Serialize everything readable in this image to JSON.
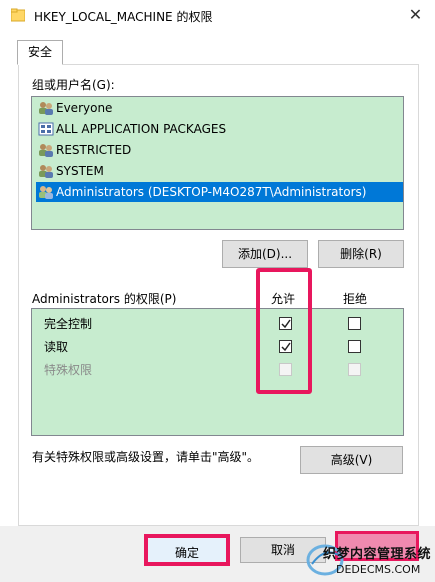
{
  "window": {
    "title": "HKEY_LOCAL_MACHINE 的权限",
    "close_glyph": "✕"
  },
  "tabs": [
    {
      "label": "安全"
    }
  ],
  "users": {
    "label": "组或用户名(G):",
    "items": [
      {
        "name": "Everyone",
        "icon": "user-group-icon"
      },
      {
        "name": "ALL APPLICATION PACKAGES",
        "icon": "app-package-icon"
      },
      {
        "name": "RESTRICTED",
        "icon": "user-group-icon"
      },
      {
        "name": "SYSTEM",
        "icon": "user-group-icon"
      },
      {
        "name": "Administrators (DESKTOP-M4O287T\\Administrators)",
        "icon": "user-group-icon",
        "selected": true
      }
    ],
    "add_label": "添加(D)...",
    "remove_label": "删除(R)"
  },
  "permissions": {
    "label": "Administrators 的权限(P)",
    "allow_header": "允许",
    "deny_header": "拒绝",
    "rows": [
      {
        "name": "完全控制",
        "allow": true,
        "deny": false,
        "enabled": true
      },
      {
        "name": "读取",
        "allow": true,
        "deny": false,
        "enabled": true
      },
      {
        "name": "特殊权限",
        "allow": false,
        "deny": false,
        "enabled": false
      }
    ]
  },
  "advanced": {
    "info": "有关特殊权限或高级设置，请单击\"高级\"。",
    "button_label": "高级(V)"
  },
  "footer": {
    "ok_label": "确定",
    "cancel_label": "取消"
  },
  "watermark": {
    "line1": "织梦内容管理系统",
    "line2": "DEDECMS.COM"
  },
  "colors": {
    "accent": "#0078d7",
    "list_background": "#c7eccf",
    "highlight": "#e8175d"
  }
}
